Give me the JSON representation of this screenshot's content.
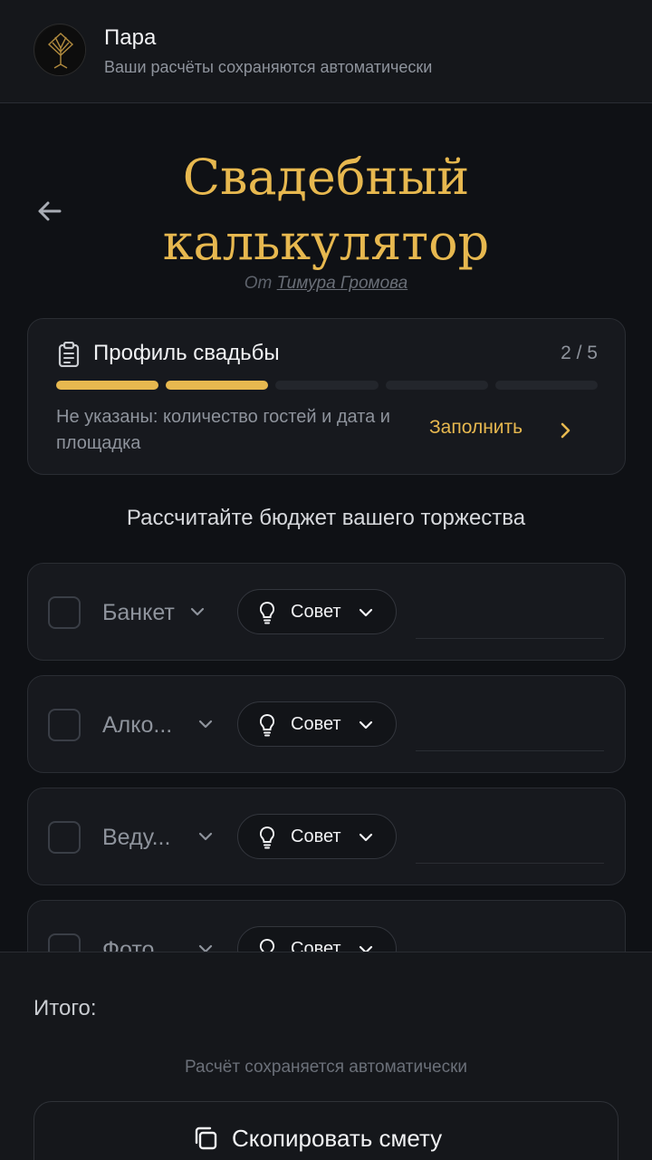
{
  "header": {
    "title": "Пара",
    "subtitle": "Ваши расчёты сохраняются автоматически"
  },
  "hero": {
    "title_line1": "Свадебный",
    "title_line2": "калькулятор",
    "author_prefix": "От",
    "author_name": "Тимура Громова"
  },
  "profile": {
    "title": "Профиль свадьбы",
    "count": "2 / 5",
    "progress_done": 2,
    "progress_total": 5,
    "missing_text": "Не указаны: количество гостей и дата и площадка",
    "fill_label": "Заполнить"
  },
  "calculator": {
    "subtitle": "Рассчитайте бюджет вашего торжества",
    "items": [
      {
        "name": "Банкет",
        "tip_label": "Совет"
      },
      {
        "name": "Алко...",
        "tip_label": "Совет"
      },
      {
        "name": "Веду...",
        "tip_label": "Совет"
      },
      {
        "name": "Фото...",
        "tip_label": "Совет"
      }
    ]
  },
  "footer": {
    "total_label": "Итого:",
    "autosave_note": "Расчёт сохраняется автоматически",
    "copy_label": "Скопировать смету"
  },
  "colors": {
    "accent": "#e7b84f",
    "background": "#0f1115",
    "card": "#17191e"
  }
}
